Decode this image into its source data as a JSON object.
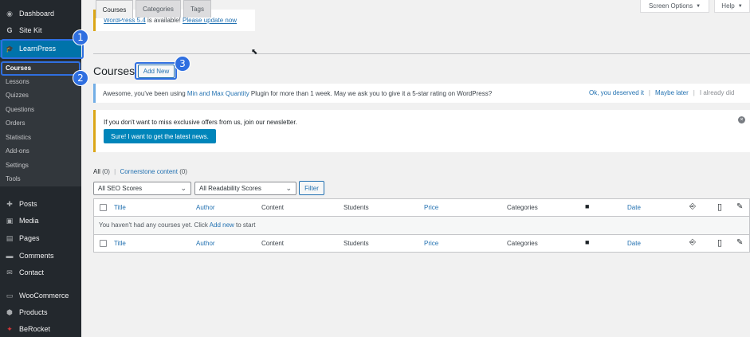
{
  "sidebar": {
    "items": [
      {
        "label": "Dashboard",
        "icon": "dashboard-icon",
        "glyph": "◉"
      },
      {
        "label": "Site Kit",
        "icon": "sitekit-g-icon",
        "glyph": "G"
      },
      {
        "label": "LearnPress",
        "icon": "graduation-cap-icon",
        "glyph": "🎓"
      },
      {
        "label": "Posts",
        "icon": "pushpin-icon",
        "glyph": "✚"
      },
      {
        "label": "Media",
        "icon": "media-icon",
        "glyph": "▣"
      },
      {
        "label": "Pages",
        "icon": "pages-icon",
        "glyph": "▤"
      },
      {
        "label": "Comments",
        "icon": "comment-icon",
        "glyph": "▬"
      },
      {
        "label": "Contact",
        "icon": "mail-icon",
        "glyph": "✉"
      },
      {
        "label": "WooCommerce",
        "icon": "woocommerce-icon",
        "glyph": "▭"
      },
      {
        "label": "Products",
        "icon": "products-icon",
        "glyph": "⬢"
      },
      {
        "label": "BeRocket",
        "icon": "rocket-icon",
        "glyph": "✦"
      }
    ],
    "submenu": [
      "Courses",
      "Lessons",
      "Quizzes",
      "Questions",
      "Orders",
      "Statistics",
      "Add-ons",
      "Settings",
      "Tools"
    ]
  },
  "callouts": [
    "1",
    "2",
    "3"
  ],
  "topbar": {
    "screen_options": "Screen Options",
    "help": "Help",
    "caret": "▼"
  },
  "update_notice": {
    "link1": "WordPress 5.4",
    "text": " is available! ",
    "link2": "Please update now"
  },
  "tabs": [
    "Courses",
    "Categories",
    "Tags"
  ],
  "page": {
    "title": "Courses",
    "add_new": "Add New"
  },
  "rating_notice": {
    "text_before": "Awesome, you've been using ",
    "plugin": "Min and Max Quantity",
    "text_after": " Plugin for more than 1 week. May we ask you to give it a 5-star rating on WordPress?",
    "action1": "Ok, you deserved it",
    "sep": "|",
    "action2": "Maybe later",
    "action3": "I already did"
  },
  "newsletter_notice": {
    "text": "If you don't want to miss exclusive offers from us, join our newsletter.",
    "button": "Sure! I want to get the latest news.",
    "dismiss": "×"
  },
  "views": {
    "all": "All",
    "all_count": "(0)",
    "sep": "|",
    "cornerstone": "Cornerstone content",
    "cornerstone_count": "(0)"
  },
  "filters": {
    "seo": "All SEO Scores",
    "readability": "All Readability Scores",
    "arrow": "⌄",
    "button": "Filter"
  },
  "table": {
    "columns": [
      "Title",
      "Author",
      "Content",
      "Students",
      "Price",
      "Categories",
      "Date"
    ],
    "icons": {
      "comments": "■",
      "seo": "⎆",
      "readability": "▯",
      "edit": "✎"
    },
    "empty": {
      "before": "You haven't had any courses yet. Click ",
      "link": "Add new",
      "after": " to start"
    }
  },
  "cursor": "⬉"
}
